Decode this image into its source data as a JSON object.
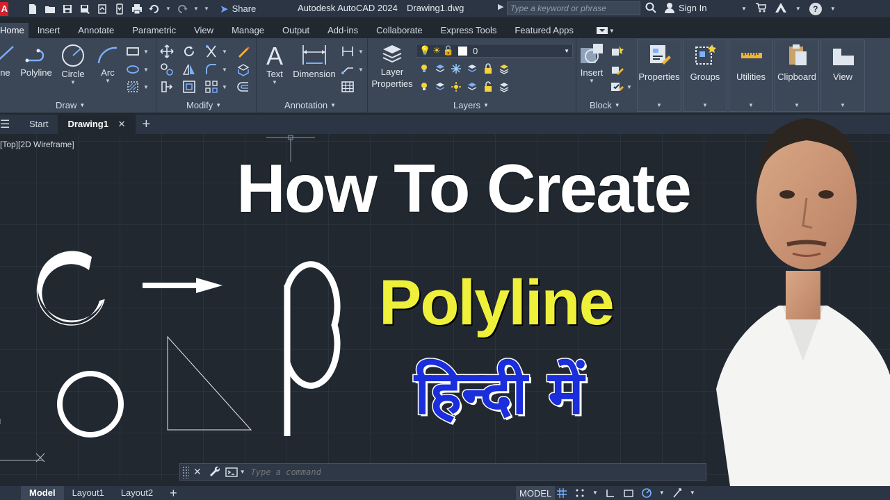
{
  "titlebar": {
    "app_logo": "A",
    "share_label": "Share",
    "app_title": "Autodesk AutoCAD 2024",
    "doc_title": "Drawing1.dwg",
    "search_placeholder": "Type a keyword or phrase",
    "sign_in_label": "Sign In",
    "help_label": "?"
  },
  "ribbon_tabs": [
    "Home",
    "Insert",
    "Annotate",
    "Parametric",
    "View",
    "Manage",
    "Output",
    "Add-ins",
    "Collaborate",
    "Express Tools",
    "Featured Apps"
  ],
  "ribbon": {
    "draw": {
      "title": "Draw",
      "line": "ine",
      "polyline": "Polyline",
      "circle": "Circle",
      "arc": "Arc"
    },
    "modify": {
      "title": "Modify"
    },
    "annotation": {
      "title": "Annotation",
      "text": "Text",
      "dimension": "Dimension"
    },
    "layers": {
      "title": "Layers",
      "layer_properties_1": "Layer",
      "layer_properties_2": "Properties",
      "current_layer": "0"
    },
    "block": {
      "title": "Block",
      "insert": "Insert"
    },
    "properties": "Properties",
    "groups": "Groups",
    "utilities": "Utilities",
    "clipboard": "Clipboard",
    "view": "View"
  },
  "file_tabs": {
    "start": "Start",
    "drawing": "Drawing1",
    "close": "✕",
    "add": "+"
  },
  "viewport_label": "[Top][2D Wireframe]",
  "thumbnail": {
    "line1": "How To Create",
    "line2": "Polyline",
    "line3": "हिन्दी में"
  },
  "command_line": {
    "placeholder": "Type a command",
    "close": "✕"
  },
  "status_bar": {
    "tabs": [
      "Model",
      "Layout1",
      "Layout2"
    ],
    "add": "+",
    "model_button": "MODEL"
  },
  "colors": {
    "canvas": "#212830",
    "ribbon": "#3b4656",
    "headline_white": "#ffffff",
    "headline_yellow": "#eef03a",
    "headline_blue": "#1a2edb"
  }
}
